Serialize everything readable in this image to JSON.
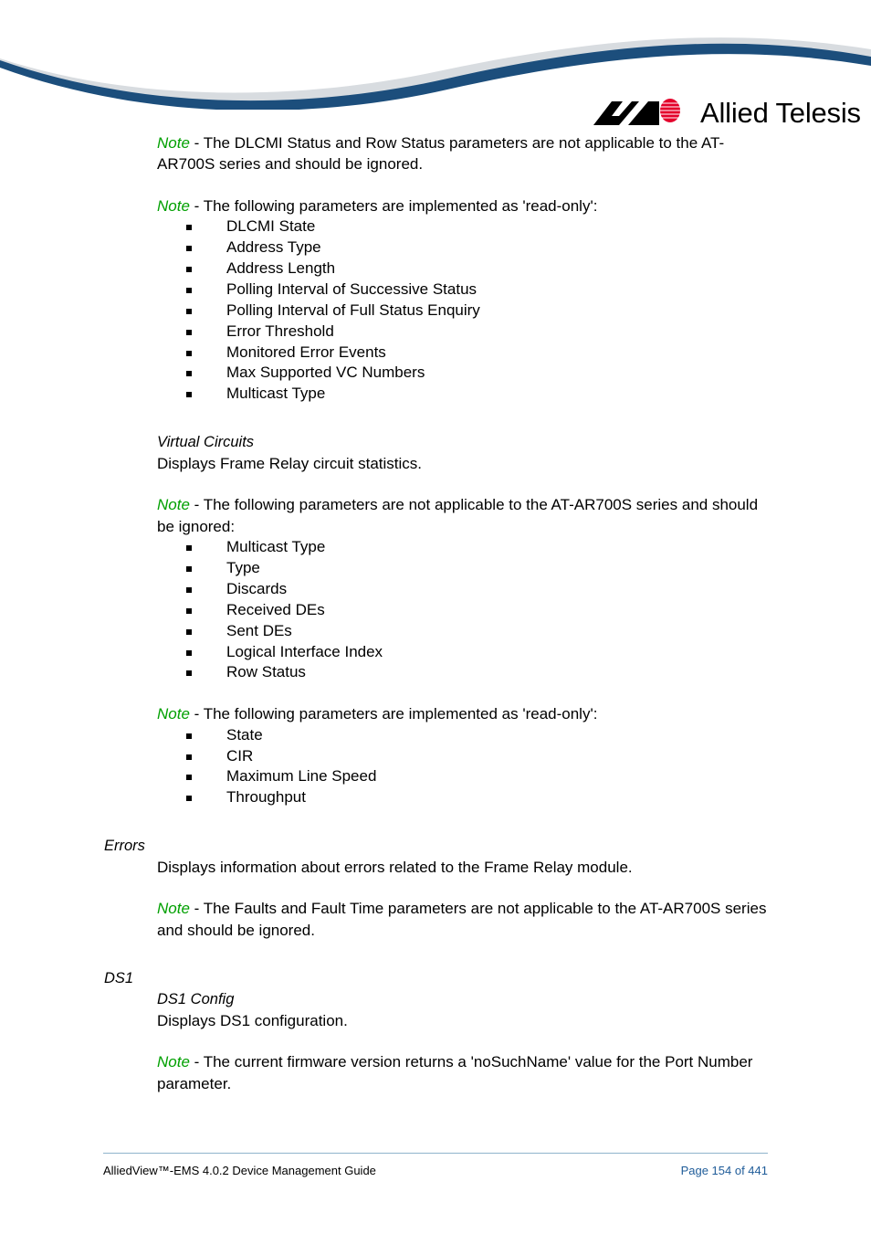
{
  "header": {
    "logo_text": "Allied Telesis",
    "logo_mark_name": "allied-telesis-av-mark",
    "wave_blue": "#1C4E7C",
    "wave_gray": "#D8DCE0"
  },
  "theme": {
    "note_green": "#00A000",
    "page_number_blue": "#1F5C99",
    "rule_blue": "#8FB4CC"
  },
  "content": {
    "note1": {
      "label": "Note",
      "text": " - The DLCMI Status and Row Status parameters are not applicable to the AT-AR700S series and should be ignored."
    },
    "note2": {
      "label": "Note",
      "text": " - The following parameters are implemented as 'read-only':"
    },
    "list1": [
      "DLCMI State",
      "Address Type",
      "Address Length",
      "Polling Interval of Successive Status",
      "Polling Interval of Full Status Enquiry",
      "Error Threshold",
      "Monitored Error Events",
      "Max Supported VC Numbers",
      "Multicast Type"
    ],
    "virtual_circuits": {
      "heading": "Virtual Circuits",
      "description": "Displays Frame Relay circuit statistics."
    },
    "note3": {
      "label": "Note",
      "text": " - The following parameters are not applicable to the AT-AR700S series and should be ignored:"
    },
    "list2": [
      "Multicast Type",
      "Type",
      "Discards",
      "Received DEs",
      "Sent DEs",
      "Logical Interface Index",
      "Row Status"
    ],
    "note4": {
      "label": "Note",
      "text": " - The following parameters are implemented as 'read-only':"
    },
    "list3": [
      "State",
      "CIR",
      "Maximum Line Speed",
      "Throughput"
    ],
    "errors": {
      "heading": "Errors",
      "description": "Displays information about errors related to the Frame Relay module."
    },
    "note5": {
      "label": "Note",
      "text": " - The Faults and Fault Time parameters are not applicable to the AT-AR700S series and should be ignored."
    },
    "ds1": {
      "heading": "DS1",
      "sub_heading": "DS1 Config",
      "description": "Displays DS1 configuration."
    },
    "note6": {
      "label": "Note",
      "text": " - The current firmware version returns a 'noSuchName' value for the Port Number parameter."
    }
  },
  "footer": {
    "left": "AlliedView™-EMS 4.0.2 Device Management Guide",
    "right": "Page 154 of 441"
  }
}
